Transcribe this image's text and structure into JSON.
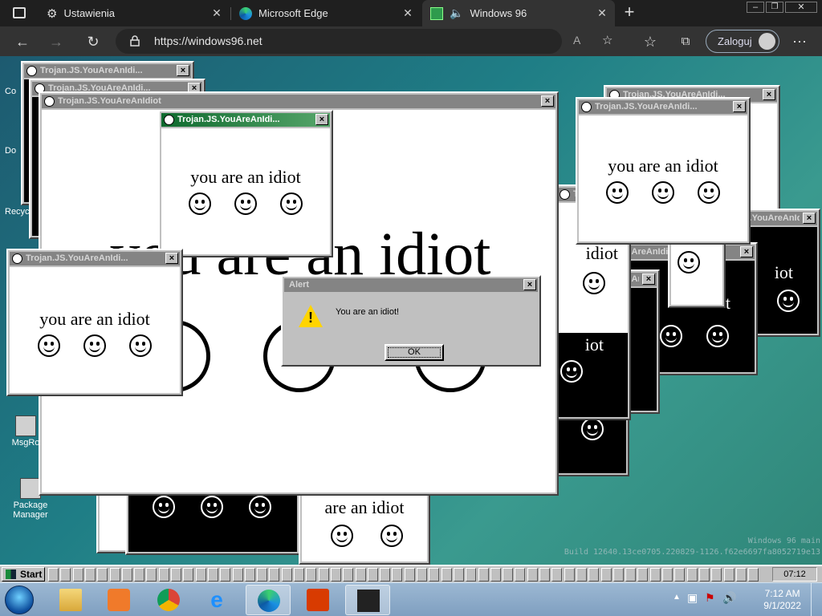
{
  "browser": {
    "tabs": [
      {
        "label": "Ustawienia",
        "icon": "gear-icon"
      },
      {
        "label": "Microsoft Edge",
        "icon": "edge-icon"
      },
      {
        "label": "Windows 96",
        "icon": "windows96-icon",
        "active": true
      }
    ],
    "address": "https://windows96.net",
    "login_label": "Zaloguj"
  },
  "desktop": {
    "icons": [
      "Co",
      "Do",
      "Recyc",
      "MsgRo",
      "Package Manager"
    ],
    "main_window_title": "Trojan.JS.YouAreAnIdiot",
    "popup_title": "Trojan.JS.YouAreAnIdi...",
    "popup_message": "you are an idiot",
    "big_message": "you are an idiot",
    "partial_messages": {
      "idiot": "idiot",
      "iot": "iot",
      "t": "t",
      "are_an_idiot": "are an idiot"
    }
  },
  "alert": {
    "title": "Alert",
    "message": "You are an idiot!",
    "ok_label": "OK"
  },
  "w96_taskbar": {
    "start_label": "Start",
    "clock": "07:12",
    "watermark_line1": "Windows 96 main",
    "watermark_line2": "Build 12640.13ce0705.220829-1126.f62e6697fa8052719e13"
  },
  "w7_taskbar": {
    "time": "7:12 AM",
    "date": "9/1/2022",
    "apps": [
      "file-explorer-icon",
      "media-player-icon",
      "chrome-icon",
      "internet-explorer-icon",
      "edge-icon",
      "office-icon",
      "butterfly-app-icon"
    ]
  },
  "colors": {
    "active_titlebar": "#0e6a2e",
    "inactive_titlebar": "#848484",
    "desktop": "#1f7e86"
  }
}
